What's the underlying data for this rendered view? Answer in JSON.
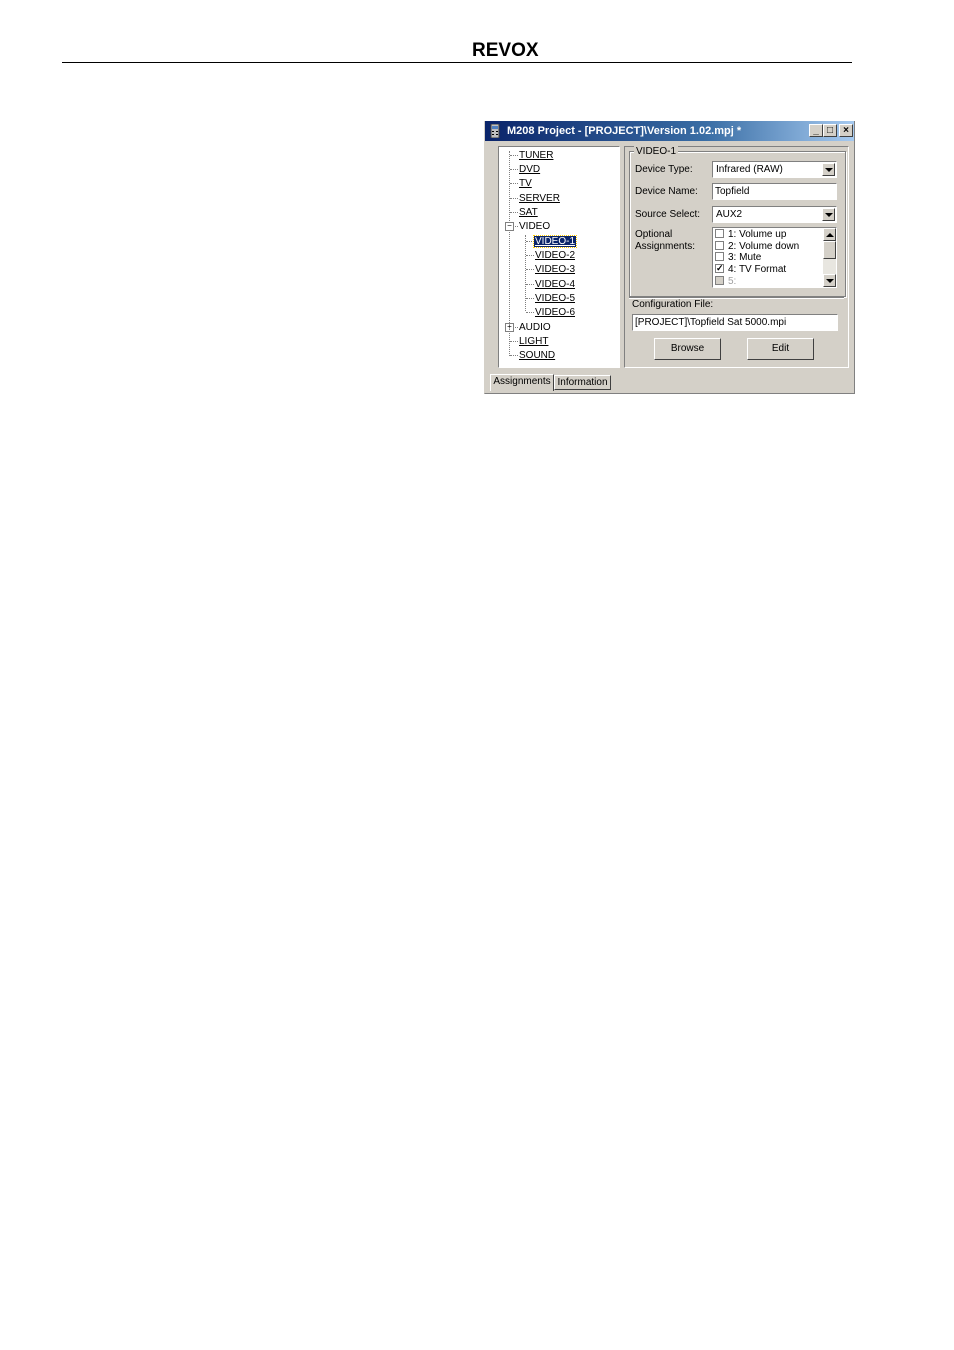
{
  "header": {
    "logo_text": "REVOX"
  },
  "window": {
    "title": "M208 Project - [PROJECT]\\Version 1.02.mpj *",
    "controls": {
      "minimize": "_",
      "maximize": "□",
      "close": "×"
    }
  },
  "tree": {
    "items": [
      {
        "label": "TUNER"
      },
      {
        "label": "DVD"
      },
      {
        "label": "TV"
      },
      {
        "label": "SERVER"
      },
      {
        "label": "SAT"
      },
      {
        "label": "VIDEO",
        "expander": "−"
      },
      {
        "label": "VIDEO-1"
      },
      {
        "label": "VIDEO-2"
      },
      {
        "label": "VIDEO-3"
      },
      {
        "label": "VIDEO-4"
      },
      {
        "label": "VIDEO-5"
      },
      {
        "label": "VIDEO-6"
      },
      {
        "label": "AUDIO",
        "expander": "+"
      },
      {
        "label": "LIGHT"
      },
      {
        "label": "SOUND"
      }
    ],
    "selected": "VIDEO-1"
  },
  "panel": {
    "group_title": "VIDEO-1",
    "device_type_label": "Device Type:",
    "device_type_value": "Infrared (RAW)",
    "device_name_label": "Device Name:",
    "device_name_value": "Topfield",
    "source_select_label": "Source Select:",
    "source_select_value": "AUX2",
    "optional_label_1": "Optional",
    "optional_label_2": "Assignments:",
    "assignments": [
      {
        "label": "1: Volume up",
        "checked": false
      },
      {
        "label": "2: Volume down",
        "checked": false
      },
      {
        "label": "3: Mute",
        "checked": false
      },
      {
        "label": "4: TV Format",
        "checked": true
      },
      {
        "label": "5:",
        "checked": false,
        "disabled": true
      }
    ],
    "config_file_label": "Configuration File:",
    "config_file_value": "[PROJECT]\\Topfield Sat 5000.mpi",
    "browse_label": "Browse",
    "edit_label": "Edit"
  },
  "tabs": [
    {
      "label": "Assignments",
      "active": true
    },
    {
      "label": "Information",
      "active": false
    }
  ]
}
